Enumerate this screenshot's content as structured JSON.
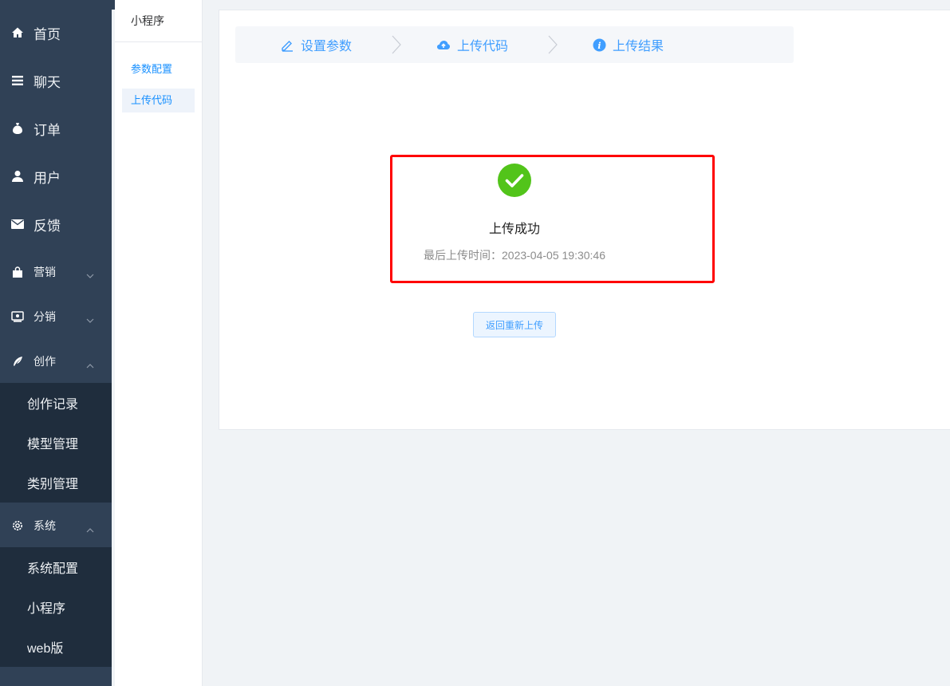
{
  "nav": {
    "items": [
      {
        "label": "首页",
        "icon": "home-icon"
      },
      {
        "label": "聊天",
        "icon": "list-icon"
      },
      {
        "label": "订单",
        "icon": "money-bag-icon"
      },
      {
        "label": "用户",
        "icon": "user-icon"
      },
      {
        "label": "反馈",
        "icon": "mail-icon"
      },
      {
        "label": "营销",
        "icon": "shopping-bag-icon"
      },
      {
        "label": "分销",
        "icon": "share-icon"
      },
      {
        "label": "创作",
        "icon": "feather-icon"
      },
      {
        "label": "系统",
        "icon": "gear-icon"
      }
    ],
    "creation_sub": [
      "创作记录",
      "模型管理",
      "类别管理"
    ],
    "system_sub": [
      "系统配置",
      "小程序",
      "web版"
    ]
  },
  "secondary_menu": {
    "title": "小程序",
    "items": [
      "参数配置",
      "上传代码"
    ],
    "active_index": 1
  },
  "steps": [
    {
      "label": "设置参数",
      "icon": "edit-icon"
    },
    {
      "label": "上传代码",
      "icon": "cloud-upload-icon"
    },
    {
      "label": "上传结果",
      "icon": "info-icon"
    }
  ],
  "result": {
    "title": "上传成功",
    "subtitle": "最后上传时间：2023-04-05 19:30:46",
    "icon": "success-check-icon"
  },
  "back_button": "返回重新上传",
  "colors": {
    "nav_bg": "#304156",
    "nav_sub_bg": "#1f2d3d",
    "accent": "#409eff",
    "success": "#52c41a",
    "highlight_border": "#ff0000"
  }
}
